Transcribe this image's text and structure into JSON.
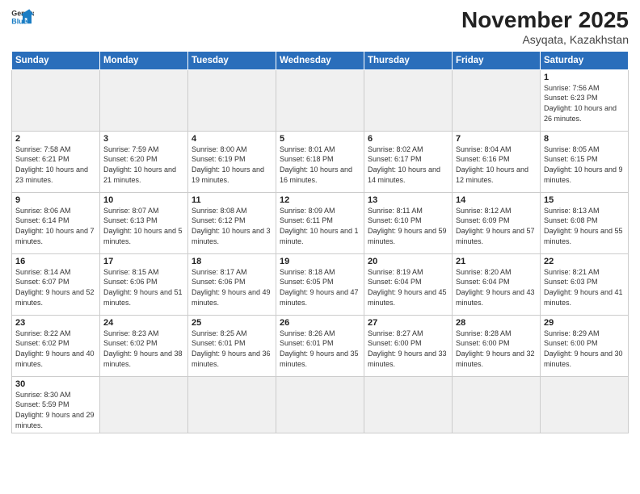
{
  "header": {
    "logo_general": "General",
    "logo_blue": "Blue",
    "month_title": "November 2025",
    "location": "Asyqata, Kazakhstan"
  },
  "weekdays": [
    "Sunday",
    "Monday",
    "Tuesday",
    "Wednesday",
    "Thursday",
    "Friday",
    "Saturday"
  ],
  "weeks": [
    [
      {
        "day": "",
        "empty": true
      },
      {
        "day": "",
        "empty": true
      },
      {
        "day": "",
        "empty": true
      },
      {
        "day": "",
        "empty": true
      },
      {
        "day": "",
        "empty": true
      },
      {
        "day": "",
        "empty": true
      },
      {
        "day": "1",
        "sunrise": "7:56 AM",
        "sunset": "6:23 PM",
        "daylight": "10 hours and 26 minutes."
      }
    ],
    [
      {
        "day": "2",
        "sunrise": "7:58 AM",
        "sunset": "6:21 PM",
        "daylight": "10 hours and 23 minutes."
      },
      {
        "day": "3",
        "sunrise": "7:59 AM",
        "sunset": "6:20 PM",
        "daylight": "10 hours and 21 minutes."
      },
      {
        "day": "4",
        "sunrise": "8:00 AM",
        "sunset": "6:19 PM",
        "daylight": "10 hours and 19 minutes."
      },
      {
        "day": "5",
        "sunrise": "8:01 AM",
        "sunset": "6:18 PM",
        "daylight": "10 hours and 16 minutes."
      },
      {
        "day": "6",
        "sunrise": "8:02 AM",
        "sunset": "6:17 PM",
        "daylight": "10 hours and 14 minutes."
      },
      {
        "day": "7",
        "sunrise": "8:04 AM",
        "sunset": "6:16 PM",
        "daylight": "10 hours and 12 minutes."
      },
      {
        "day": "8",
        "sunrise": "8:05 AM",
        "sunset": "6:15 PM",
        "daylight": "10 hours and 9 minutes."
      }
    ],
    [
      {
        "day": "9",
        "sunrise": "8:06 AM",
        "sunset": "6:14 PM",
        "daylight": "10 hours and 7 minutes."
      },
      {
        "day": "10",
        "sunrise": "8:07 AM",
        "sunset": "6:13 PM",
        "daylight": "10 hours and 5 minutes."
      },
      {
        "day": "11",
        "sunrise": "8:08 AM",
        "sunset": "6:12 PM",
        "daylight": "10 hours and 3 minutes."
      },
      {
        "day": "12",
        "sunrise": "8:09 AM",
        "sunset": "6:11 PM",
        "daylight": "10 hours and 1 minute."
      },
      {
        "day": "13",
        "sunrise": "8:11 AM",
        "sunset": "6:10 PM",
        "daylight": "9 hours and 59 minutes."
      },
      {
        "day": "14",
        "sunrise": "8:12 AM",
        "sunset": "6:09 PM",
        "daylight": "9 hours and 57 minutes."
      },
      {
        "day": "15",
        "sunrise": "8:13 AM",
        "sunset": "6:08 PM",
        "daylight": "9 hours and 55 minutes."
      }
    ],
    [
      {
        "day": "16",
        "sunrise": "8:14 AM",
        "sunset": "6:07 PM",
        "daylight": "9 hours and 52 minutes."
      },
      {
        "day": "17",
        "sunrise": "8:15 AM",
        "sunset": "6:06 PM",
        "daylight": "9 hours and 51 minutes."
      },
      {
        "day": "18",
        "sunrise": "8:17 AM",
        "sunset": "6:06 PM",
        "daylight": "9 hours and 49 minutes."
      },
      {
        "day": "19",
        "sunrise": "8:18 AM",
        "sunset": "6:05 PM",
        "daylight": "9 hours and 47 minutes."
      },
      {
        "day": "20",
        "sunrise": "8:19 AM",
        "sunset": "6:04 PM",
        "daylight": "9 hours and 45 minutes."
      },
      {
        "day": "21",
        "sunrise": "8:20 AM",
        "sunset": "6:04 PM",
        "daylight": "9 hours and 43 minutes."
      },
      {
        "day": "22",
        "sunrise": "8:21 AM",
        "sunset": "6:03 PM",
        "daylight": "9 hours and 41 minutes."
      }
    ],
    [
      {
        "day": "23",
        "sunrise": "8:22 AM",
        "sunset": "6:02 PM",
        "daylight": "9 hours and 40 minutes."
      },
      {
        "day": "24",
        "sunrise": "8:23 AM",
        "sunset": "6:02 PM",
        "daylight": "9 hours and 38 minutes."
      },
      {
        "day": "25",
        "sunrise": "8:25 AM",
        "sunset": "6:01 PM",
        "daylight": "9 hours and 36 minutes."
      },
      {
        "day": "26",
        "sunrise": "8:26 AM",
        "sunset": "6:01 PM",
        "daylight": "9 hours and 35 minutes."
      },
      {
        "day": "27",
        "sunrise": "8:27 AM",
        "sunset": "6:00 PM",
        "daylight": "9 hours and 33 minutes."
      },
      {
        "day": "28",
        "sunrise": "8:28 AM",
        "sunset": "6:00 PM",
        "daylight": "9 hours and 32 minutes."
      },
      {
        "day": "29",
        "sunrise": "8:29 AM",
        "sunset": "6:00 PM",
        "daylight": "9 hours and 30 minutes."
      }
    ],
    [
      {
        "day": "30",
        "sunrise": "8:30 AM",
        "sunset": "5:59 PM",
        "daylight": "9 hours and 29 minutes."
      },
      {
        "day": "",
        "empty": true
      },
      {
        "day": "",
        "empty": true
      },
      {
        "day": "",
        "empty": true
      },
      {
        "day": "",
        "empty": true
      },
      {
        "day": "",
        "empty": true
      },
      {
        "day": "",
        "empty": true
      }
    ]
  ]
}
